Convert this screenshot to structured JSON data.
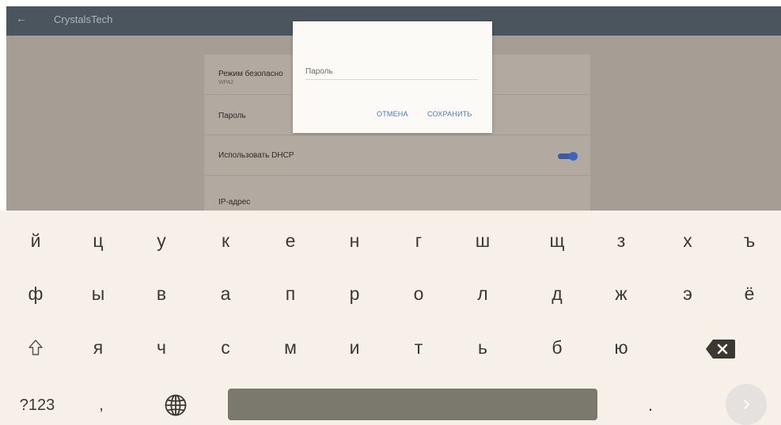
{
  "app_bar": {
    "back_icon": "arrow-left-icon",
    "title": "CrystalsTech"
  },
  "settings": {
    "security_label": "Режим безопасно",
    "security_value": "WPA2",
    "password_label": "Пароль",
    "dhcp_label": "Использовать DHCP",
    "dhcp_enabled": true,
    "ip_label": "IP-адрес"
  },
  "dialog": {
    "input_placeholder": "Пароль",
    "cancel_label": "ОТМЕНА",
    "save_label": "СОХРАНИТЬ"
  },
  "keyboard": {
    "row1": [
      "й",
      "ц",
      "у",
      "к",
      "е",
      "н",
      "г",
      "ш",
      "щ",
      "з",
      "х",
      "ъ"
    ],
    "row2": [
      "ф",
      "ы",
      "в",
      "а",
      "п",
      "р",
      "о",
      "л",
      "д",
      "ж",
      "э",
      "ё"
    ],
    "row3": [
      "я",
      "ч",
      "с",
      "м",
      "и",
      "т",
      "ь",
      "б",
      "ю"
    ],
    "shift_icon": "shift-arrow-icon",
    "backspace_icon": "backspace-icon",
    "symbols_label": "?123",
    "comma_label": ",",
    "globe_icon": "globe-icon",
    "period_label": ".",
    "enter_icon": "chevron-right-icon"
  },
  "colors": {
    "app_bar": "#4a555e",
    "scrim": "#a69d94",
    "keyboard_bg": "#f6f0e9",
    "accent": "#4a74d8",
    "spacebar": "#7b786d"
  }
}
